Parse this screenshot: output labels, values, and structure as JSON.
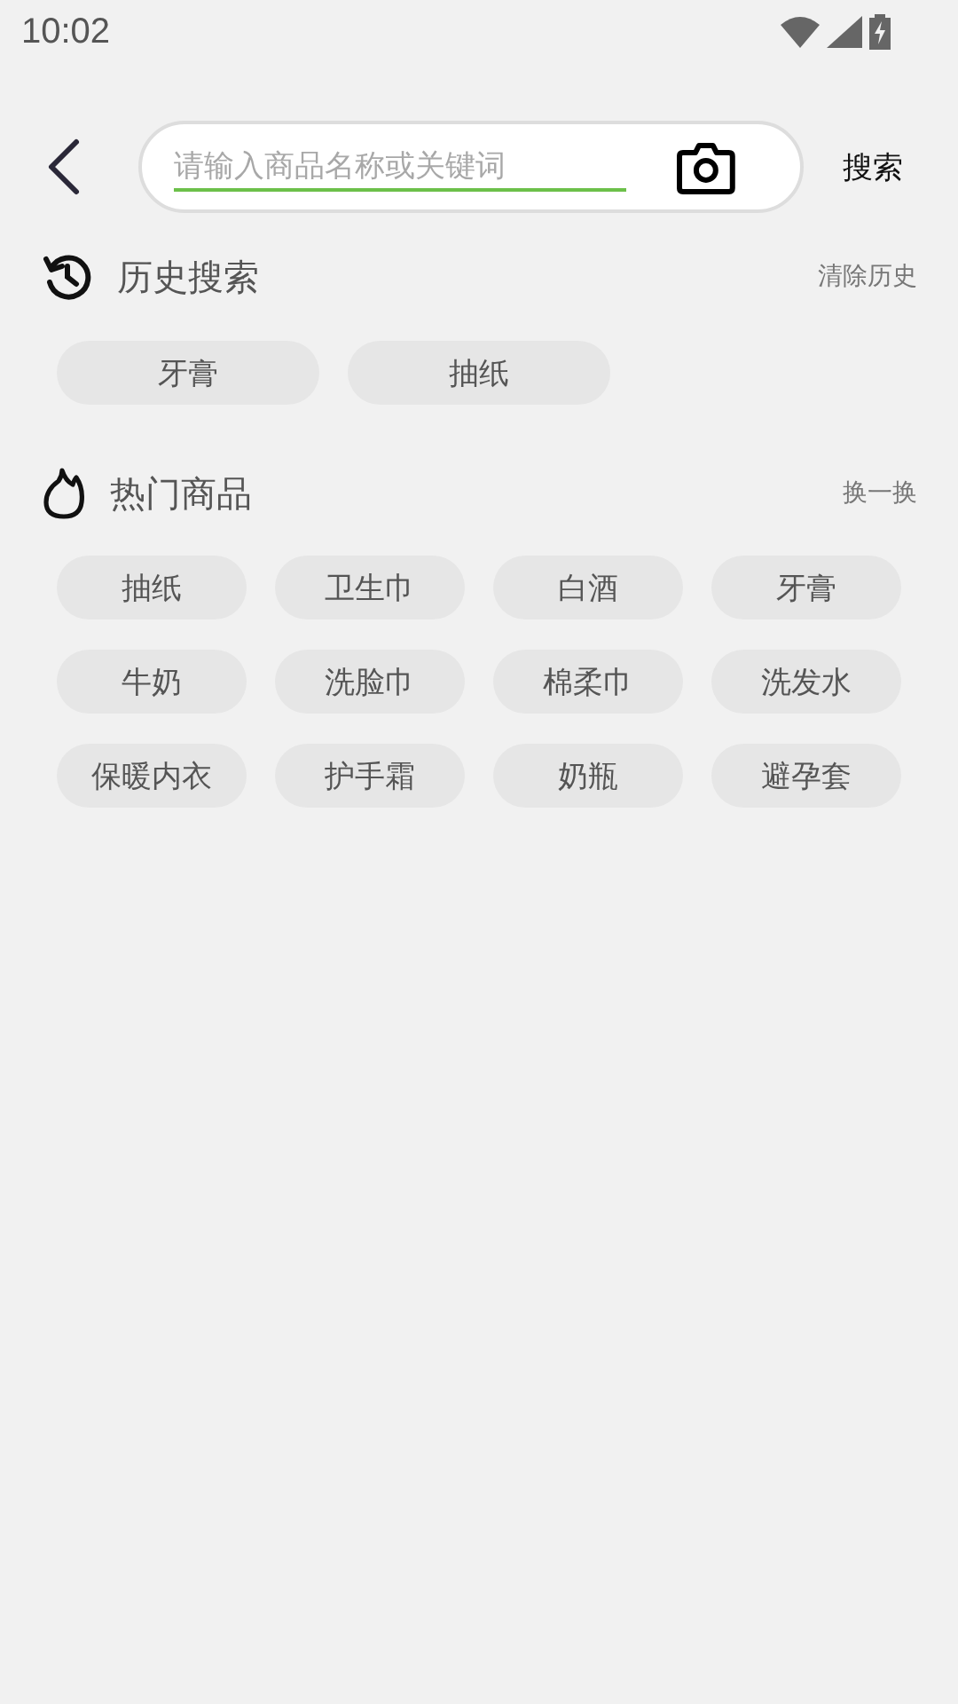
{
  "status_bar": {
    "time": "10:02"
  },
  "search": {
    "placeholder": "请输入商品名称或关键词",
    "button": "搜索"
  },
  "history": {
    "title": "历史搜索",
    "action": "清除历史",
    "items": [
      "牙膏",
      "抽纸"
    ]
  },
  "hot": {
    "title": "热门商品",
    "action": "换一换",
    "items": [
      "抽纸",
      "卫生巾",
      "白酒",
      "牙膏",
      "牛奶",
      "洗脸巾",
      "棉柔巾",
      "洗发水",
      "保暖内衣",
      "护手霜",
      "奶瓶",
      "避孕套"
    ]
  }
}
